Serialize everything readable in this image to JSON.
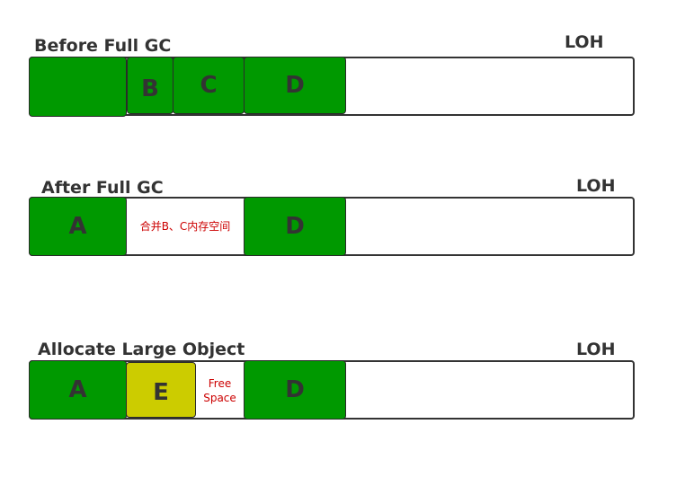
{
  "rows": [
    {
      "title": "Before Full GC",
      "loh": "LOH",
      "blocks": [
        "",
        "B",
        "C",
        "D"
      ]
    },
    {
      "title": "After Full GC",
      "loh": "LOH",
      "blocks": [
        "A",
        "D"
      ],
      "note": "合并B、C内存空间"
    },
    {
      "title": "Allocate Large Object",
      "loh": "LOH",
      "blocks": [
        "A",
        "E",
        "D"
      ],
      "note_line1": "Free",
      "note_line2": "Space"
    }
  ],
  "colors": {
    "allocated": "#009900",
    "new_object": "#cccc00",
    "note_text": "#cc0000",
    "outline": "#333333"
  }
}
